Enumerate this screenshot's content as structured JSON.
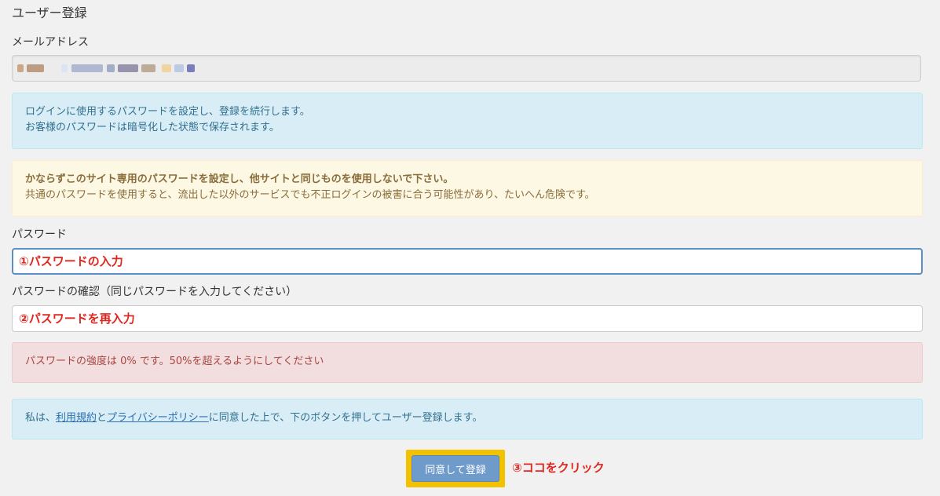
{
  "page": {
    "title": "ユーザー登録"
  },
  "email": {
    "label": "メールアドレス",
    "value_blurred": true
  },
  "info_password": {
    "line1": "ログインに使用するパスワードを設定し、登録を続行します。",
    "line2": "お客様のパスワードは暗号化した状態で保存されます。"
  },
  "warning": {
    "title": "かならずこのサイト専用のパスワードを設定し、他サイトと同じものを使用しないで下さい。",
    "body": "共通のパスワードを使用すると、流出した以外のサービスでも不正ログインの被害に合う可能性があり、たいへん危険です。"
  },
  "password": {
    "label": "パスワード",
    "value": "①パスワードの入力"
  },
  "password_confirm": {
    "label": "パスワードの確認（同じパスワードを入力してください）",
    "value": "②パスワードを再入力"
  },
  "strength": {
    "message": "パスワードの強度は 0% です。50%を超えるようにしてください"
  },
  "terms": {
    "prefix": "私は、",
    "terms_link": "利用規約",
    "and": "と",
    "privacy_link": "プライバシーポリシー",
    "suffix": "に同意した上で、下のボタンを押してユーザー登録します。"
  },
  "submit": {
    "label": "同意して登録"
  },
  "annotation": {
    "text": "③ココをクリック"
  },
  "colors": {
    "info_bg": "#d9edf7",
    "warning_bg": "#fcf8e3",
    "danger_bg": "#f2dede",
    "button": "#6f9bcb",
    "highlight": "#f2c200",
    "annotation": "#e0261e"
  }
}
